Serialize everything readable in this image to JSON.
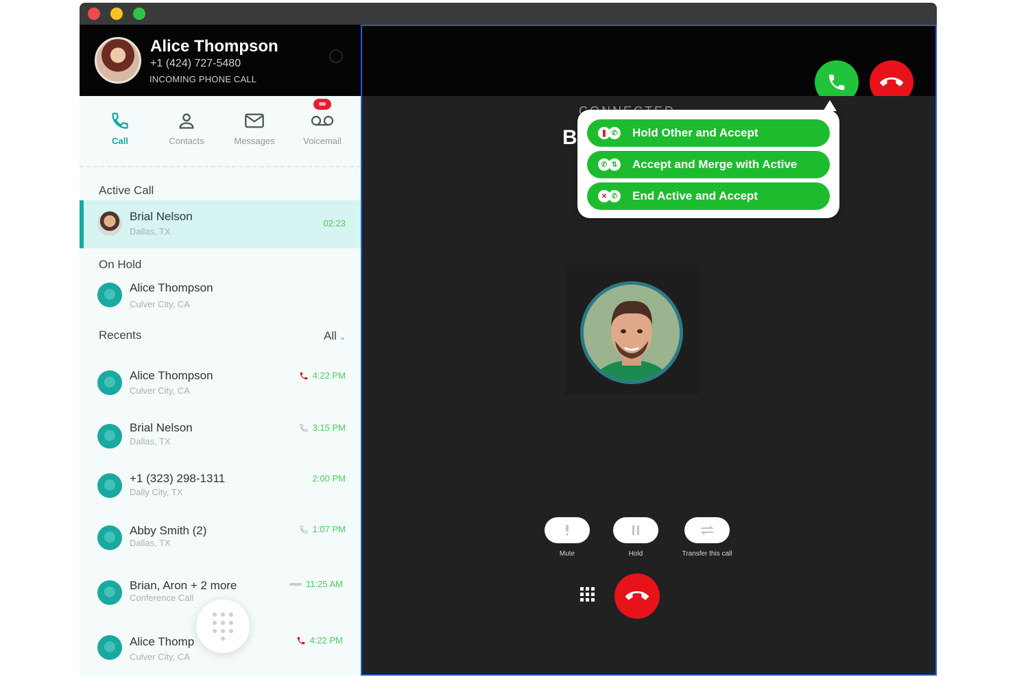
{
  "incoming": {
    "caller_name": "Alice Thompson",
    "caller_number": "+1 (424) 727-5480",
    "status": "INCOMING PHONE CALL"
  },
  "nav": {
    "items": [
      {
        "label": "Call",
        "icon": "phone-icon",
        "active": true
      },
      {
        "label": "Contacts",
        "icon": "person-icon"
      },
      {
        "label": "Messages",
        "icon": "envelope-icon"
      },
      {
        "label": "Voicemail",
        "icon": "voicemail-icon"
      }
    ]
  },
  "active_call": {
    "title": "Active Call",
    "name": "Brial Nelson",
    "location": "Dallas, TX",
    "duration": "02:23"
  },
  "on_hold": {
    "title": "On Hold",
    "name": "Alice Thompson",
    "location": "Culver City, CA"
  },
  "recents": {
    "title": "Recents",
    "filter": "All",
    "items": [
      {
        "name": "Alice Thompson",
        "sub": "Culver City, CA",
        "time": "4:22 PM",
        "icon": "missed-call-icon"
      },
      {
        "name": "Brial Nelson",
        "sub": "Dallas, TX",
        "time": "3:15 PM",
        "icon": "outgoing-call-icon"
      },
      {
        "name": "+1 (323) 298-1311",
        "sub": "Dally City, TX",
        "time": "2:00 PM",
        "icon": ""
      },
      {
        "name": "Abby Smith (2)",
        "sub": "Dallas, TX",
        "time": "1:07 PM",
        "icon": "outgoing-call-icon"
      },
      {
        "name": "Brian, Aron + 2 more",
        "sub": "Conference Call",
        "time": "11:25 AM",
        "icon": "conference-icon"
      },
      {
        "name": "Alice Thomp",
        "sub": "Culver City, CA",
        "time": "4:22 PM",
        "icon": "missed-call-icon"
      }
    ]
  },
  "call_options": [
    {
      "label": "Hold Other and Accept"
    },
    {
      "label": "Accept and Merge with Active"
    },
    {
      "label": "End Active and Accept"
    }
  ],
  "controls": {
    "mute": "Mute",
    "hold": "Hold",
    "transfer": "Transfer this call"
  },
  "colors": {
    "accent_teal": "#19a9a0",
    "accept_green": "#1fc43a",
    "decline_red": "#e8121b",
    "option_green": "#1dbc2f"
  }
}
